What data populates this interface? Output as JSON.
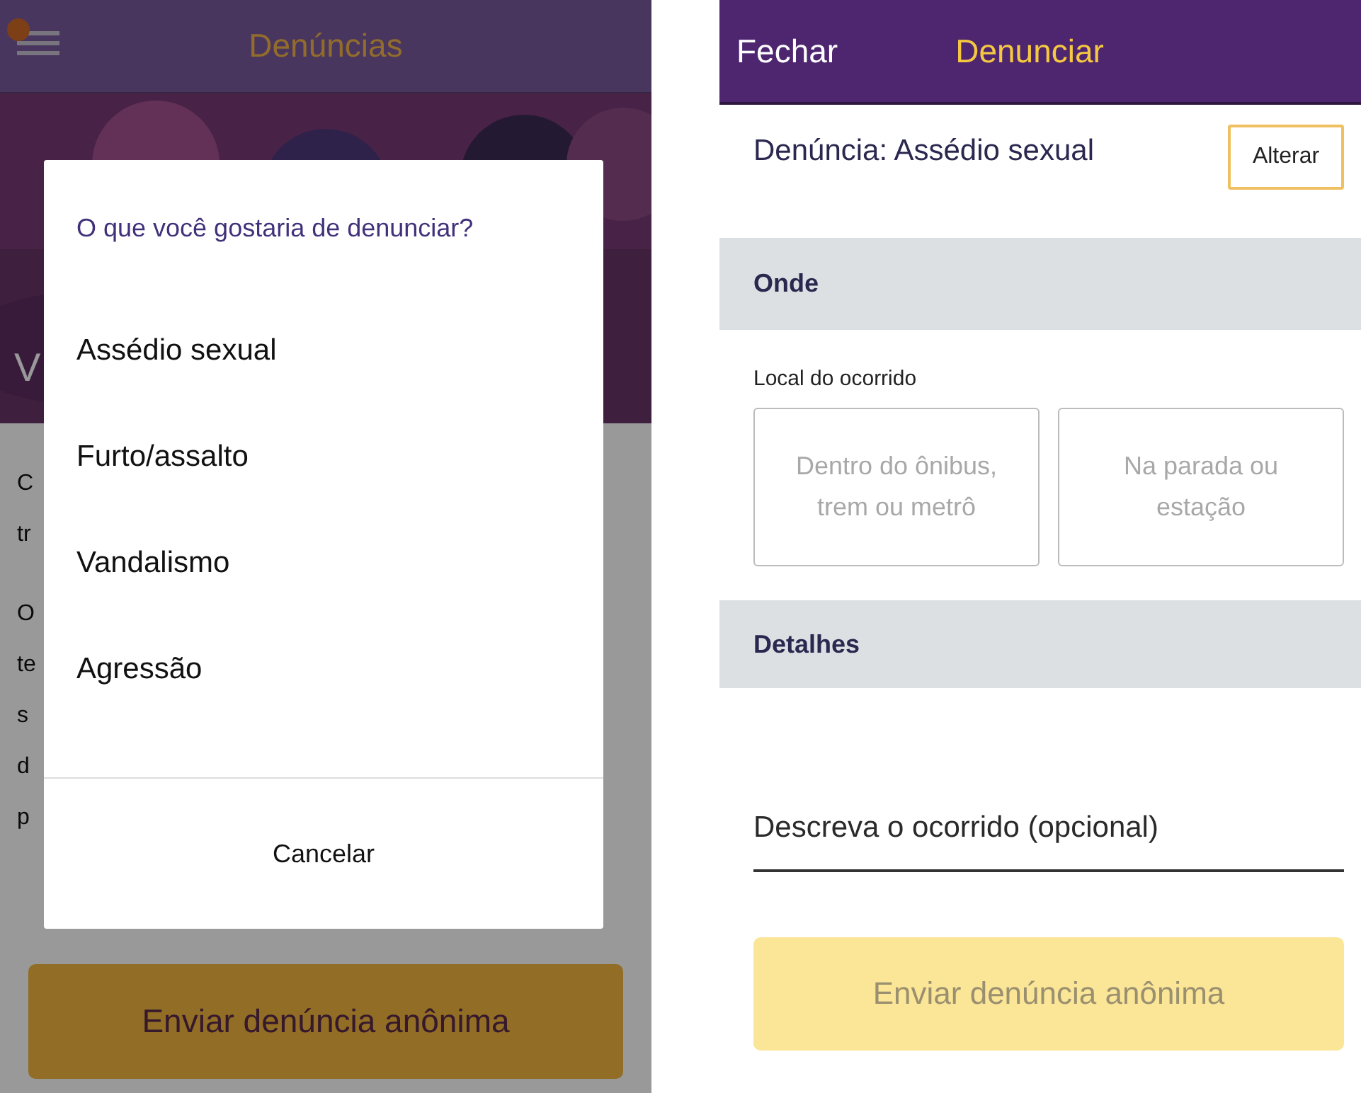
{
  "menu_screen": {
    "title": "Denúncias",
    "banner_text": "V",
    "body_fragments": [
      [
        "C",
        "tr"
      ],
      [
        "O",
        "te",
        "s",
        "d",
        "p"
      ]
    ],
    "submit_button": {
      "label": "Enviar denúncia anônima",
      "disabled": false
    },
    "dialog": {
      "title": "O que você gostaria de denunciar?",
      "options": [
        {
          "label": "Assédio sexual"
        },
        {
          "label": "Furto/assalto"
        },
        {
          "label": "Vandalismo"
        },
        {
          "label": "Agressão"
        }
      ],
      "cancel": "Cancelar"
    }
  },
  "report_screen": {
    "close": "Fechar",
    "title": "Denunciar",
    "report_type": "Denúncia: Assédio sexual",
    "change_button": "Alterar",
    "where": {
      "heading": "Onde",
      "label": "Local do ocorrido",
      "options": [
        {
          "label": "Dentro do ônibus, trem ou metrô",
          "selected": false
        },
        {
          "label": "Na parada ou estação",
          "selected": false
        }
      ]
    },
    "details": {
      "heading": "Detalhes",
      "placeholder": "Descreva o ocorrido (opcional)"
    },
    "submit_button": {
      "label": "Enviar denúncia anônima",
      "disabled": true
    }
  }
}
